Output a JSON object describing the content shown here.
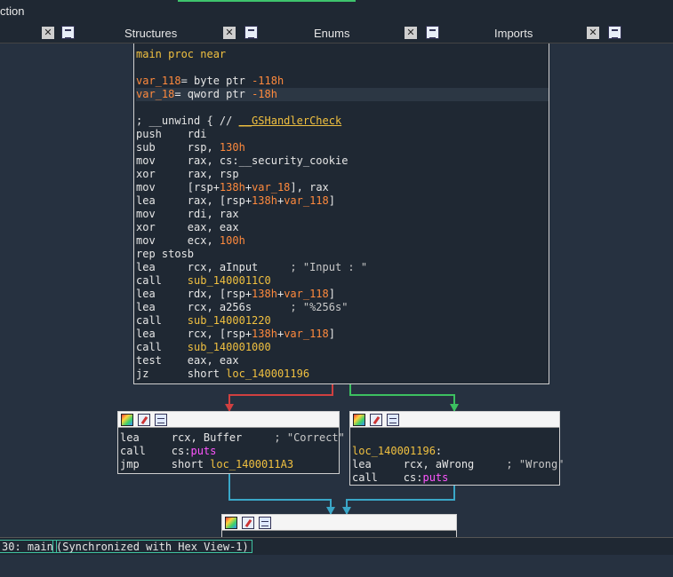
{
  "window": {
    "title_fragment": "ction"
  },
  "tabs": [
    {
      "label": "Structures"
    },
    {
      "label": "Enums"
    },
    {
      "label": "Imports"
    }
  ],
  "main_block": {
    "lines": [
      [
        "kw-y",
        "main proc near"
      ],
      [
        "",
        ""
      ],
      [
        "var118",
        "var_118= byte ptr -118h"
      ],
      [
        "var18",
        "var_18= qword ptr -18h"
      ],
      [
        "",
        ""
      ],
      [
        "cmt",
        "; __unwind { // __GSHandlerCheck"
      ],
      [
        "ins",
        "push    rdi"
      ],
      [
        "ins",
        "sub     rsp, 130h"
      ],
      [
        "ins",
        "mov     rax, cs:__security_cookie"
      ],
      [
        "ins",
        "xor     rax, rsp"
      ],
      [
        "ins",
        "mov     [rsp+138h+var_18], rax"
      ],
      [
        "ins",
        "lea     rax, [rsp+138h+var_118]"
      ],
      [
        "ins",
        "mov     rdi, rax"
      ],
      [
        "ins",
        "xor     eax, eax"
      ],
      [
        "ins",
        "mov     ecx, 100h"
      ],
      [
        "ins",
        "rep stosb"
      ],
      [
        "ins",
        "lea     rcx, aInput     ; \"Input : \""
      ],
      [
        "ins",
        "call    sub_1400011C0"
      ],
      [
        "ins",
        "lea     rdx, [rsp+138h+var_118]"
      ],
      [
        "ins",
        "lea     rcx, a256s      ; \"%256s\""
      ],
      [
        "ins",
        "call    sub_140001220"
      ],
      [
        "ins",
        "lea     rcx, [rsp+138h+var_118]"
      ],
      [
        "ins",
        "call    sub_140001000"
      ],
      [
        "ins",
        "test    eax, eax"
      ],
      [
        "ins",
        "jz      short loc_140001196"
      ]
    ]
  },
  "left_block": {
    "lines": [
      "lea     rcx, Buffer     ; \"Correct\"",
      "call    cs:puts",
      "jmp     short loc_1400011A3"
    ]
  },
  "right_block": {
    "lines": [
      "",
      "loc_140001196:",
      "lea     rcx, aWrong     ; \"Wrong\"",
      "call    cs:puts"
    ]
  },
  "status": {
    "address": "30: main",
    "sync": "(Synchronized with Hex View-1)"
  },
  "colors": {
    "edge_false": "#d04040",
    "edge_true": "#3cc060",
    "edge_jump": "#3aa7c8"
  }
}
